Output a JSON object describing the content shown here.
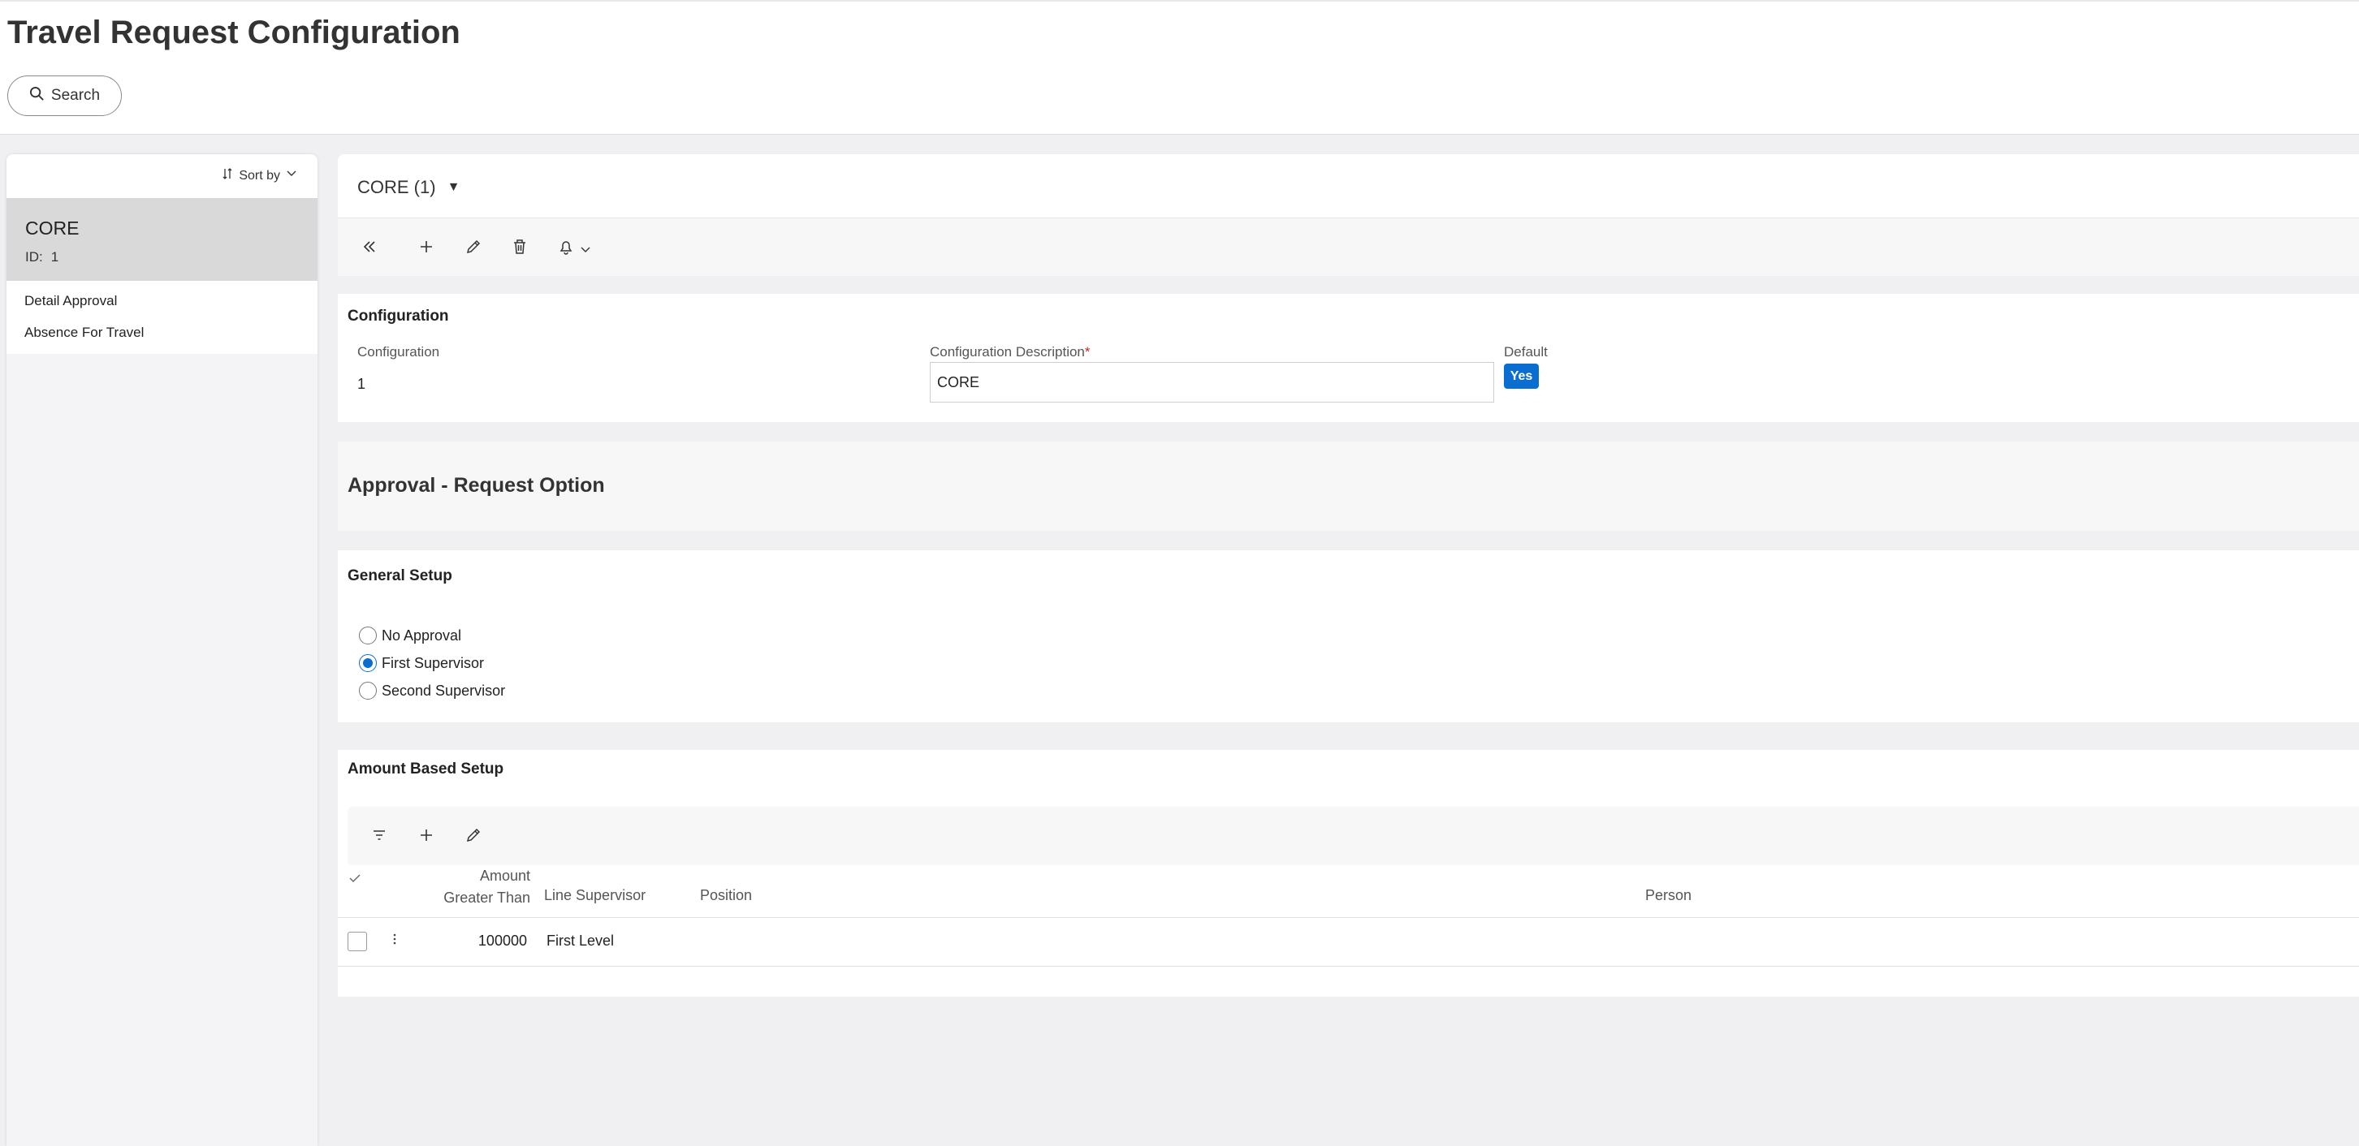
{
  "page": {
    "title": "Travel Request Configuration"
  },
  "search": {
    "label": "Search"
  },
  "list": {
    "sort_label": "Sort by",
    "selected": {
      "name": "CORE",
      "id_label": "ID:",
      "id_value": "1"
    },
    "links": [
      "Detail Approval",
      "Absence For Travel"
    ]
  },
  "detail": {
    "header_title": "CORE (1)",
    "toolbar_icons": [
      "collapse-icon",
      "add-icon",
      "edit-icon",
      "delete-icon",
      "bell-icon",
      "chevron-down-icon"
    ]
  },
  "configuration": {
    "section_title": "Configuration",
    "config_label": "Configuration",
    "config_value": "1",
    "desc_label": "Configuration Description",
    "desc_required_mark": "*",
    "desc_value": "CORE",
    "default_label": "Default",
    "default_value": "Yes"
  },
  "approval": {
    "title": "Approval - Request Option"
  },
  "general": {
    "title": "General Setup",
    "options": [
      {
        "label": "No Approval",
        "selected": false
      },
      {
        "label": "First Supervisor",
        "selected": true
      },
      {
        "label": "Second Supervisor",
        "selected": false
      }
    ]
  },
  "amount": {
    "title": "Amount Based Setup",
    "columns": {
      "amount_line1": "Amount",
      "amount_line2": "Greater Than",
      "line_supervisor": "Line Supervisor",
      "position": "Position",
      "person": "Person"
    },
    "rows": [
      {
        "amount": "100000",
        "line_supervisor": "First Level",
        "position": "",
        "person": ""
      }
    ]
  },
  "colors": {
    "accent": "#0a6ed1",
    "selected_row": "#d9d9d9"
  }
}
